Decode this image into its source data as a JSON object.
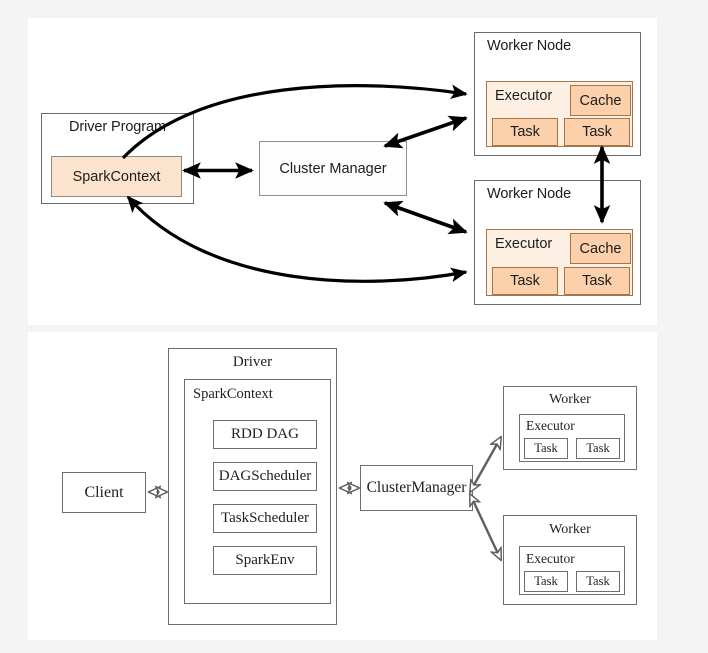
{
  "page": {
    "background_color": "#f4f4f4",
    "card_color": "#ffffff"
  },
  "colors": {
    "peach_fill": "#fbd0ab",
    "peach_light": "#fdf0e3",
    "peach_context": "#fce3cd",
    "box_stroke": "#6b6b6b",
    "peach_stroke": "#a8754a",
    "arrow_color": "#000000",
    "serif_stroke": "#6e6e6e"
  },
  "top_diagram": {
    "name": "spark-cluster-overview",
    "driver": {
      "title": "Driver Program",
      "spark_context": "SparkContext"
    },
    "cluster_manager": {
      "label": "Cluster Manager"
    },
    "workers": [
      {
        "title": "Worker Node",
        "executor": "Executor",
        "cache": "Cache",
        "tasks": [
          "Task",
          "Task"
        ]
      },
      {
        "title": "Worker Node",
        "executor": "Executor",
        "cache": "Cache",
        "tasks": [
          "Task",
          "Task"
        ]
      }
    ],
    "connections": [
      {
        "from": "SparkContext",
        "to": "Cluster Manager",
        "style": "double-arrow-straight"
      },
      {
        "from": "SparkContext",
        "to": "Worker Node 1 Executor",
        "style": "curved-arrow"
      },
      {
        "from": "Worker Node 2 Executor",
        "to": "SparkContext",
        "style": "curved-arrow"
      },
      {
        "from": "Cluster Manager",
        "to": "Worker Node 1",
        "style": "double-arrow"
      },
      {
        "from": "Cluster Manager",
        "to": "Worker Node 2",
        "style": "double-arrow"
      },
      {
        "from": "Worker Node 1 Executor",
        "to": "Worker Node 2 Cache",
        "style": "double-arrow-vertical"
      }
    ]
  },
  "bottom_diagram": {
    "name": "spark-driver-internals",
    "client": {
      "label": "Client"
    },
    "driver": {
      "title": "Driver",
      "spark_context": {
        "title": "SparkContext",
        "components": [
          "RDD DAG",
          "DAGScheduler",
          "TaskScheduler",
          "SparkEnv"
        ]
      }
    },
    "cluster_manager": {
      "label": "ClusterManager"
    },
    "workers": [
      {
        "title": "Worker",
        "executor": "Executor",
        "tasks": [
          "Task",
          "Task"
        ]
      },
      {
        "title": "Worker",
        "executor": "Executor",
        "tasks": [
          "Task",
          "Task"
        ]
      }
    ],
    "connections": [
      {
        "from": "Client",
        "to": "Driver",
        "style": "hollow-double-arrow"
      },
      {
        "from": "Driver",
        "to": "ClusterManager",
        "style": "hollow-double-arrow"
      },
      {
        "from": "ClusterManager",
        "to": "Worker 1",
        "style": "hollow-double-arrow-diagonal"
      },
      {
        "from": "ClusterManager",
        "to": "Worker 2",
        "style": "hollow-double-arrow-diagonal"
      }
    ]
  }
}
